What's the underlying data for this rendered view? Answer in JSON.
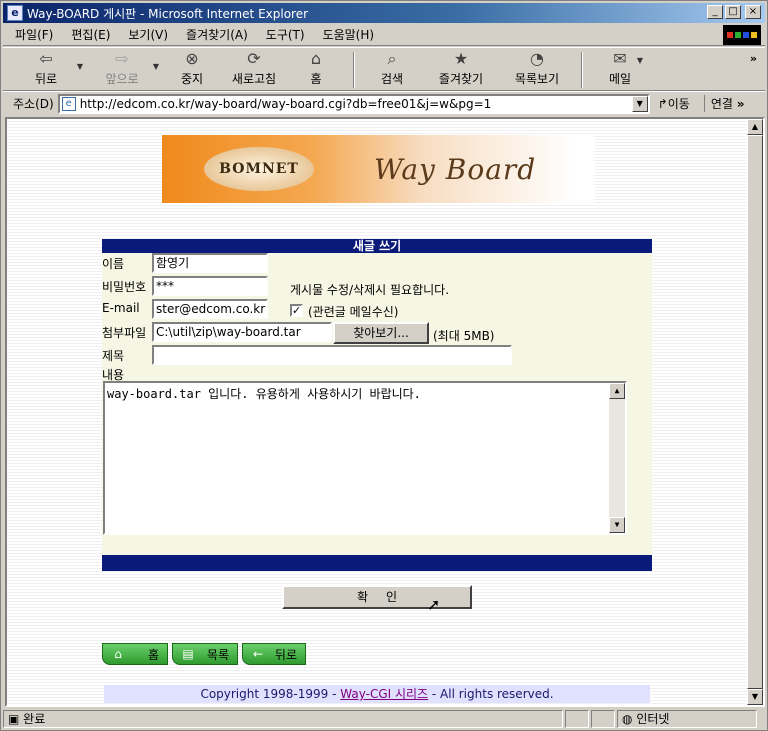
{
  "window": {
    "title": "Way-BOARD 게시판 - Microsoft Internet Explorer",
    "btn_min": "_",
    "btn_max": "□",
    "btn_close": "×"
  },
  "menu": [
    "파일(F)",
    "편집(E)",
    "보기(V)",
    "즐겨찾기(A)",
    "도구(T)",
    "도움말(H)"
  ],
  "toolbar": {
    "back": "뒤로",
    "forward": "앞으로",
    "stop": "중지",
    "refresh": "새로고침",
    "home": "홈",
    "search": "검색",
    "favorites": "즐겨찾기",
    "history": "목록보기",
    "mail": "메일",
    "more": "»"
  },
  "addressbar": {
    "label": "주소(D)",
    "url": "http://edcom.co.kr/way-board/way-board.cgi?db=free01&j=w&pg=1",
    "go": "이동",
    "links": "연결",
    "links_more": "»"
  },
  "banner": {
    "logo_text": "BOMNET",
    "title": "Way Board"
  },
  "form": {
    "header": "새글 쓰기",
    "name_label": "이름",
    "name_value": "함영기",
    "password_label": "비밀번호",
    "password_value": "***",
    "password_hint": "게시물 수정/삭제시 필요합니다.",
    "email_label": "E-mail",
    "email_value": "ster@edcom.co.kr",
    "notify_label": "(관련글 메일수신)",
    "notify_checked": "✓",
    "attach_label": "첨부파일",
    "attach_value": "C:\\util\\zip\\way-board.tar",
    "browse_label": "찾아보기...",
    "attach_max": "(최대 5MB)",
    "subject_label": "제목",
    "subject_value": "",
    "content_label": "내용",
    "content_value": "way-board.tar 입니다. 유용하게 사용하시기 바랍니다."
  },
  "submit_label": "확인",
  "nav": {
    "home": "홈",
    "list": "목록",
    "back": "뒤로"
  },
  "copyright": {
    "prefix": "Copyright 1998-1999 - ",
    "link": "Way-CGI 시리즈",
    "suffix": " - All rights reserved."
  },
  "status": {
    "text": "완료",
    "zone": "인터넷"
  }
}
